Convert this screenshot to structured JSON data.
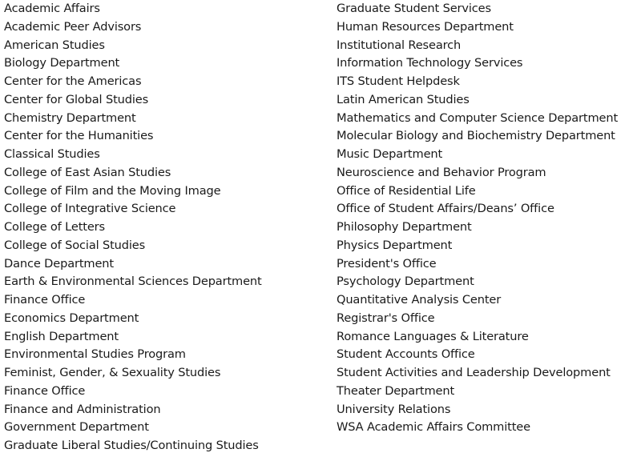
{
  "document": {
    "left_column": [
      "Academic Affairs",
      "Academic Peer Advisors",
      "American Studies",
      "Biology Department",
      "Center for the Americas",
      "Center for Global Studies",
      "Chemistry Department",
      "Center for the Humanities",
      "Classical Studies",
      "College of East Asian Studies",
      "College of Film and the Moving Image",
      "College of Integrative Science",
      "College of Letters",
      "College of Social Studies",
      "Dance Department",
      "Earth & Environmental Sciences Department",
      "Finance Office",
      "Economics Department",
      "English Department",
      "Environmental Studies Program",
      "Feminist, Gender, & Sexuality Studies",
      "Finance Office",
      "Finance and Administration",
      "Government Department",
      "Graduate Liberal Studies/Continuing Studies"
    ],
    "right_column": [
      "Graduate Student Services",
      "Human Resources Department",
      "Institutional Research",
      "Information Technology Services",
      "ITS Student Helpdesk",
      "Latin American Studies",
      "Mathematics and Computer Science Department",
      "Molecular Biology and Biochemistry Department",
      "Music Department",
      "Neuroscience and Behavior Program",
      "Office of Residential Life",
      "Office of Student Affairs/Deans’ Office",
      "Philosophy Department",
      "Physics Department",
      "President's Office",
      "Psychology Department",
      "Quantitative Analysis Center",
      "Registrar's Office",
      "Romance Languages & Literature",
      "Student Accounts Office",
      "Student Activities and Leadership Development",
      "Theater Department",
      "University Relations",
      "WSA Academic Affairs Committee"
    ]
  }
}
